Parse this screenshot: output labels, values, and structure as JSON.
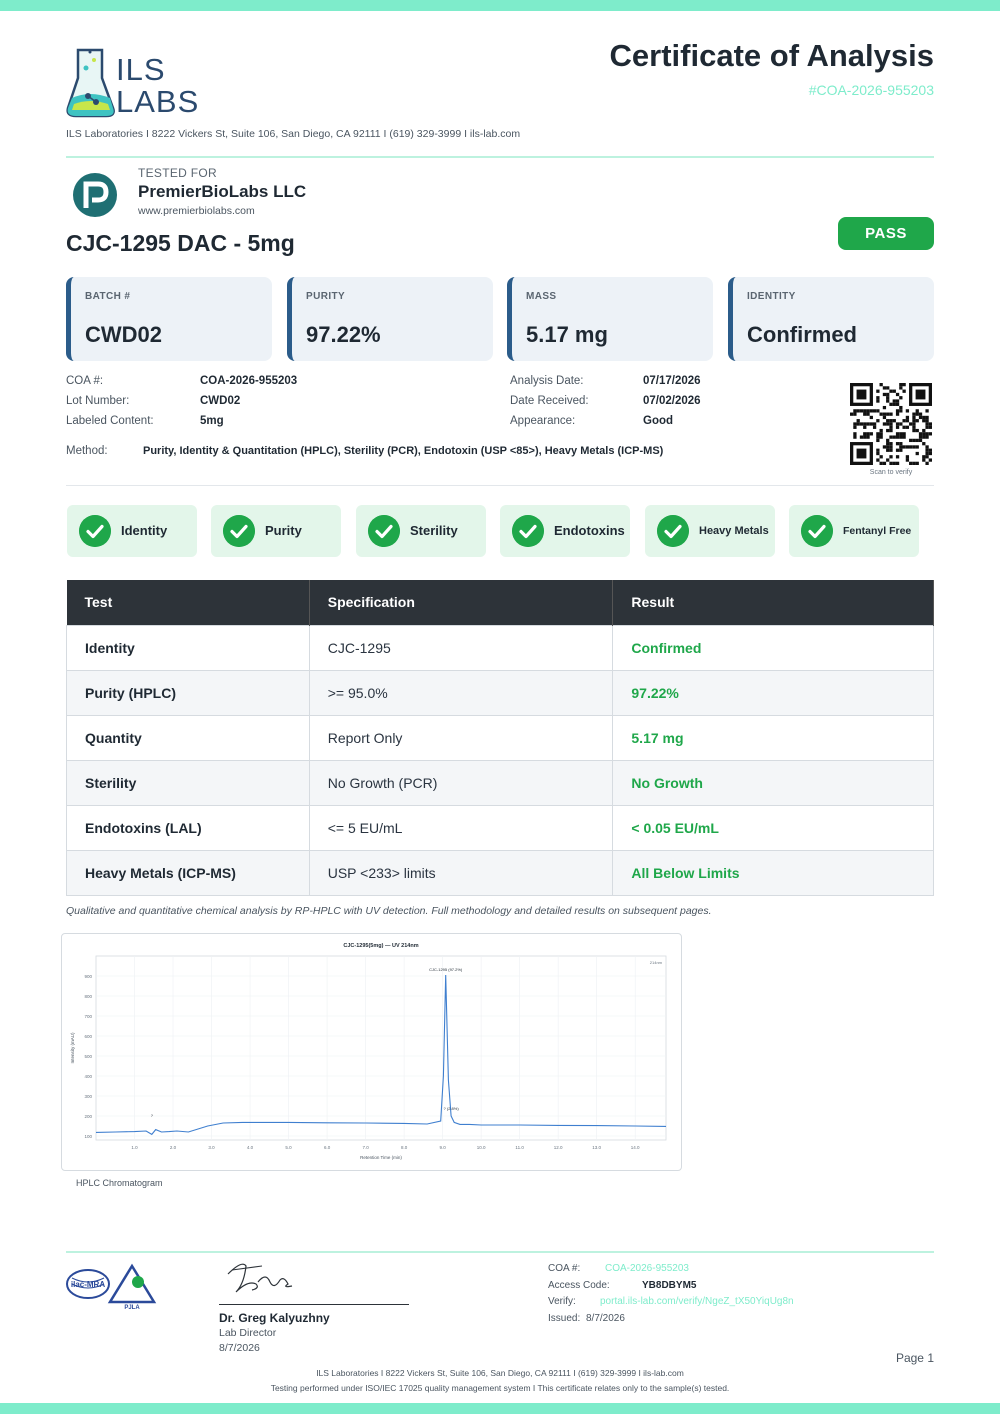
{
  "header": {
    "logo_top": "ILS",
    "logo_bottom": "LABS",
    "title": "Certificate of Analysis",
    "coa_number": "#COA-2026-955203",
    "address": "ILS Laboratories  I  8222 Vickers St, Suite 106, San Diego, CA 92111  I  (619) 329-3999  I  ils-lab.com"
  },
  "client": {
    "tested_for_label": "TESTED FOR",
    "name": "PremierBioLabs LLC",
    "url": "www.premierbiolabs.com"
  },
  "product": {
    "name": "CJC-1295 DAC - 5mg",
    "status": "PASS"
  },
  "cards": [
    {
      "label": "BATCH #",
      "value": "CWD02"
    },
    {
      "label": "PURITY",
      "value": "97.22%"
    },
    {
      "label": "MASS",
      "value": "5.17 mg"
    },
    {
      "label": "IDENTITY",
      "value": "Confirmed"
    }
  ],
  "info_left": [
    {
      "label": "COA #:",
      "value": "COA-2026-955203"
    },
    {
      "label": "Lot Number:",
      "value": "CWD02"
    },
    {
      "label": "Labeled Content:",
      "value": "5mg"
    }
  ],
  "info_right": [
    {
      "label": "Analysis Date:",
      "value": "07/17/2026"
    },
    {
      "label": "Date Received:",
      "value": "07/02/2026"
    },
    {
      "label": "Appearance:",
      "value": "Good"
    }
  ],
  "method": {
    "label": "Method:",
    "value": "Purity, Identity & Quantitation (HPLC), Sterility (PCR), Endotoxin (USP <85>), Heavy Metals (ICP-MS)"
  },
  "qr_caption": "Scan to verify",
  "badges": [
    "Identity",
    "Purity",
    "Sterility",
    "Endotoxins",
    "Heavy Metals",
    "Fentanyl Free"
  ],
  "table": {
    "headers": [
      "Test",
      "Specification",
      "Result"
    ],
    "rows": [
      {
        "test": "Identity",
        "spec": "CJC-1295",
        "result": "Confirmed"
      },
      {
        "test": "Purity (HPLC)",
        "spec": ">= 95.0%",
        "result": "97.22%"
      },
      {
        "test": "Quantity",
        "spec": "Report Only",
        "result": "5.17 mg"
      },
      {
        "test": "Sterility",
        "spec": "No Growth (PCR)",
        "result": "No Growth"
      },
      {
        "test": "Endotoxins (LAL)",
        "spec": "<= 5 EU/mL",
        "result": "< 0.05 EU/mL"
      },
      {
        "test": "Heavy Metals (ICP-MS)",
        "spec": "USP <233> limits",
        "result": "All Below Limits"
      }
    ]
  },
  "method_note": "Qualitative and quantitative chemical analysis by RP-HPLC with UV detection. Full methodology and detailed results on subsequent pages.",
  "chart_data": {
    "type": "line",
    "title": "CJC-1295(5mg) — UV 214nm",
    "xlabel": "Retention Time (min)",
    "ylabel": "Intensity (mAU)",
    "xlim": [
      0,
      14.8
    ],
    "ylim": [
      80,
      1000
    ],
    "xticks": [
      "1.0",
      "2.0",
      "3.0",
      "4.0",
      "5.0",
      "6.0",
      "7.0",
      "8.0",
      "9.0",
      "10.0",
      "11.0",
      "12.0",
      "13.0",
      "14.0"
    ],
    "yticks": [
      "100",
      "200",
      "300",
      "400",
      "500",
      "600",
      "700",
      "800",
      "900"
    ],
    "x": [
      0,
      0.5,
      1.0,
      1.3,
      1.45,
      1.55,
      1.7,
      1.9,
      2.1,
      2.4,
      2.9,
      3.3,
      3.8,
      5,
      6,
      7,
      8,
      8.6,
      8.95,
      9.02,
      9.08,
      9.15,
      9.22,
      9.3,
      9.45,
      9.7,
      10,
      11,
      12,
      13,
      14,
      14.8
    ],
    "y": [
      118,
      120,
      122,
      125,
      108,
      132,
      120,
      122,
      125,
      120,
      150,
      165,
      168,
      168,
      166,
      165,
      163,
      160,
      175,
      400,
      905,
      380,
      200,
      168,
      158,
      158,
      155,
      155,
      153,
      152,
      150,
      148
    ],
    "annotations": [
      {
        "label": "CJC-1295 (97.2%)",
        "x": 9.08,
        "y": 905
      },
      {
        "label": "?",
        "x": 1.45,
        "y": 175
      },
      {
        "label": "? (2.8%)",
        "x": 9.22,
        "y": 210
      }
    ],
    "legend": "top-right",
    "legend_label": "214nm"
  },
  "chromatogram_caption": "HPLC Chromatogram",
  "signature": {
    "name": "Dr. Greg Kalyuzhny",
    "title": "Lab Director",
    "date": "8/7/2026"
  },
  "accreditation": {
    "ilac": "ilac-MRA",
    "pjla": "PJLA"
  },
  "footer_info": {
    "coa_label": "COA #:",
    "coa_value": "COA-2026-955203",
    "access_label": "Access Code:",
    "access_value": "YB8DBYM5",
    "verify_label": "Verify:",
    "verify_value": "portal.ils-lab.com/verify/NgeZ_tX50YiqUg8n",
    "issued_label": "Issued:",
    "issued_value": "8/7/2026"
  },
  "page_label": "Page 1",
  "footer": {
    "line1": "ILS Laboratories  I  8222 Vickers St, Suite 106, San Diego, CA 92111  I  (619) 329-3999  I  ils-lab.com",
    "line2": "Testing performed under ISO/IEC 17025 quality management system  I  This certificate relates only to the sample(s) tested."
  },
  "colors": {
    "accent": "#7eeccb",
    "pass": "#1fa74a",
    "navy": "#2b4a6e",
    "table_header": "#2d3339"
  }
}
